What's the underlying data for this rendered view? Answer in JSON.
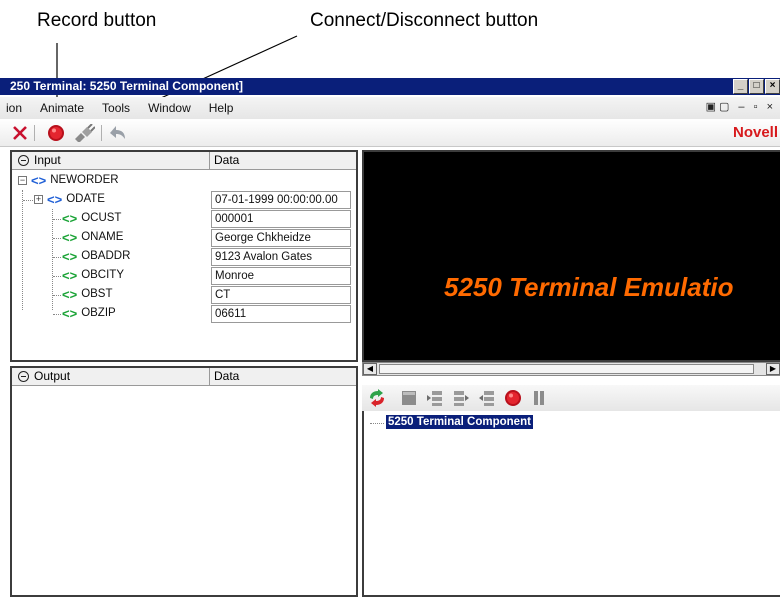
{
  "annotations": {
    "record_callout": "Record button",
    "connect_callout": "Connect/Disconnect button"
  },
  "window": {
    "title": "250 Terminal: 5250 Terminal Component]"
  },
  "menu": {
    "items": [
      "ion",
      "Animate",
      "Tools",
      "Window",
      "Help"
    ]
  },
  "toolbar": {
    "icons": [
      "close-icon",
      "record-icon",
      "connect-disconnect-icon",
      "undo-icon"
    ],
    "brand": "Novell"
  },
  "input_panel": {
    "header_col1": "Input",
    "header_col2": "Data",
    "root": "NEWORDER",
    "rows": [
      {
        "name": "ODATE",
        "value": "07-01-1999 00:00:00.00"
      },
      {
        "name": "OCUST",
        "value": "000001"
      },
      {
        "name": "ONAME",
        "value": "George Chkheidze"
      },
      {
        "name": "OBADDR",
        "value": "9123 Avalon Gates"
      },
      {
        "name": "OBCITY",
        "value": "Monroe"
      },
      {
        "name": "OBST",
        "value": "CT"
      },
      {
        "name": "OBZIP",
        "value": "06611"
      }
    ]
  },
  "output_panel": {
    "header_col1": "Output",
    "header_col2": "Data"
  },
  "terminal": {
    "banner": "5250 Terminal Emulatio"
  },
  "component_tree": {
    "node": "5250 Terminal Component"
  },
  "colors": {
    "titlebar": "#0a1f7a",
    "brand": "#d7191c",
    "terminal_text": "#ff6a00",
    "tag_blue": "#1f5fd6",
    "tag_green": "#1aa336"
  }
}
